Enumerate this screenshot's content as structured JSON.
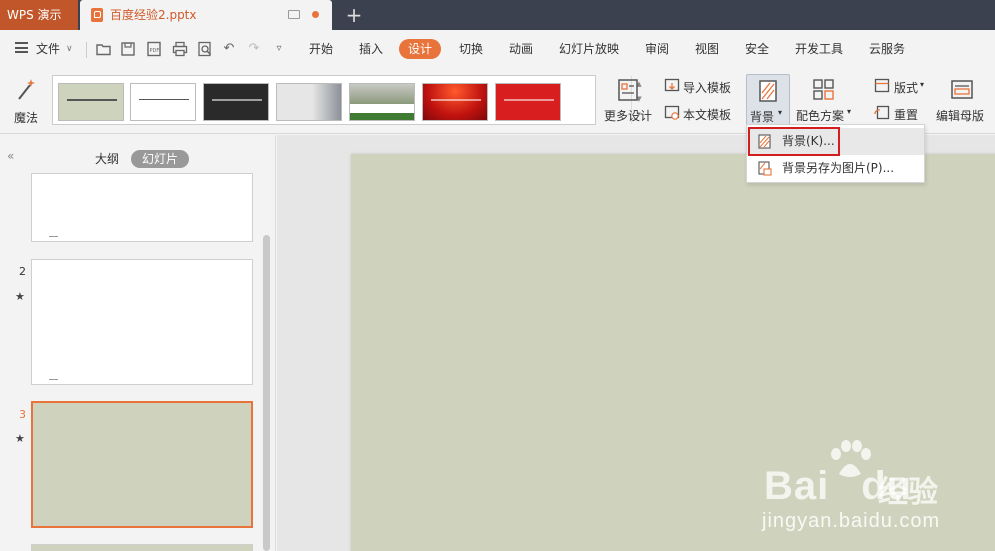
{
  "titlebar": {
    "app_name": "WPS 演示",
    "doc_title": "百度经验2.pptx",
    "new_tab_icon": "plus-icon"
  },
  "menubar": {
    "file_label": "文件",
    "tabs": [
      "开始",
      "插入",
      "设计",
      "切换",
      "动画",
      "幻灯片放映",
      "审阅",
      "视图",
      "安全",
      "开发工具",
      "云服务"
    ],
    "active_tab": "设计",
    "accent_color": "#e8743b"
  },
  "ribbon": {
    "magic_label": "魔法",
    "more_design_label": "更多设计",
    "import_template_label": "导入模板",
    "this_template_label": "本文模板",
    "background_label": "背景",
    "color_scheme_label": "配色方案",
    "layout_label": "版式",
    "reset_label": "重置",
    "edit_master_label": "编辑母版",
    "gallery_thumbs": [
      "template-1",
      "template-2",
      "template-3",
      "template-4",
      "template-5",
      "template-6",
      "template-7"
    ]
  },
  "dropdown": {
    "items": [
      {
        "label": "背景(K)...",
        "icon": "background-icon",
        "highlighted": true
      },
      {
        "label": "背景另存为图片(P)...",
        "icon": "save-image-icon",
        "highlighted": false
      }
    ],
    "highlight_color": "#d21e1e"
  },
  "panel": {
    "tab_outline": "大纲",
    "tab_slides": "幻灯片",
    "active_tab": "幻灯片",
    "slides": [
      {
        "number": "",
        "selected": false
      },
      {
        "number": "2",
        "selected": false
      },
      {
        "number": "3",
        "selected": true
      },
      {
        "number": "",
        "selected": false
      }
    ],
    "slide_bg": "#cfd3bd"
  },
  "watermark": {
    "brand": "Bai",
    "brand2": "du",
    "cn": "经验",
    "url": "jingyan.baidu.com"
  }
}
